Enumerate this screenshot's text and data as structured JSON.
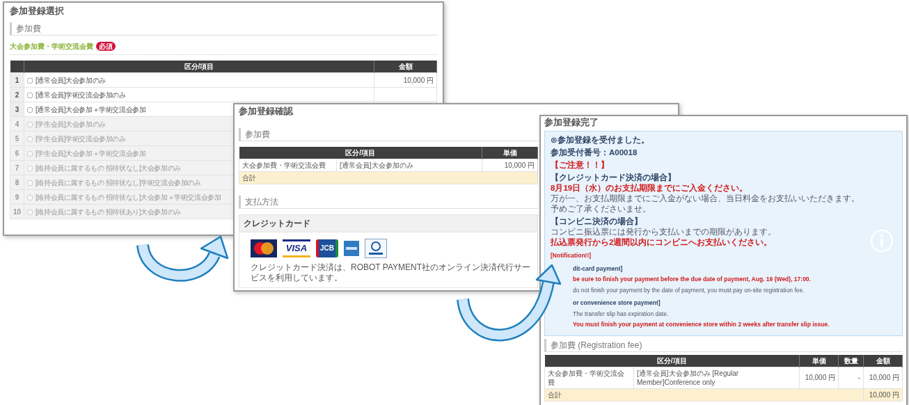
{
  "selection_window": {
    "title": "参加登録選択",
    "section": "参加費",
    "group": {
      "title": "大会参加費・学術交流会費",
      "badge": "必須"
    },
    "table": {
      "columns": [
        "区分/項目",
        "金額"
      ],
      "rows": [
        {
          "no": "1",
          "item": "[通常会員]大会参加のみ",
          "amount": "10,000 円",
          "checked": false,
          "disabled": false
        },
        {
          "no": "2",
          "item": "[通常会員]学術交流会参加のみ",
          "checked": false,
          "disabled": false
        },
        {
          "no": "3",
          "item": "[通常会員]大会参加＋学術交流会参加",
          "checked": false,
          "disabled": false
        },
        {
          "no": "4",
          "item": "[学生会員]大会参加のみ",
          "checked": false,
          "disabled": true
        },
        {
          "no": "5",
          "item": "[学生会員]学術交流会参加のみ",
          "checked": false,
          "disabled": true
        },
        {
          "no": "6",
          "item": "[学生会員]大会参加＋学術交流会参加",
          "checked": false,
          "disabled": true
        },
        {
          "no": "7",
          "item": "[維持会員に属するもの 招待状なし]大会参加のみ",
          "checked": false,
          "disabled": true
        },
        {
          "no": "8",
          "item": "[維持会員に属するもの 招待状なし]学術交流会参加のみ",
          "checked": false,
          "disabled": true
        },
        {
          "no": "9",
          "item": "[維持会員に属するもの 招待状なし]大会参加＋学術交流会参加",
          "checked": false,
          "disabled": true
        },
        {
          "no": "10",
          "item": "[維持会員に属するもの 招待状あり]大会参加のみ",
          "checked": false,
          "disabled": true
        }
      ]
    }
  },
  "confirm_window": {
    "title": "参加登録確認",
    "section": "参加費",
    "table": {
      "columns": [
        "区分/項目",
        "単価"
      ],
      "rows": [
        {
          "category": "大会参加費・学術交流会費",
          "item": "[通常会員]大会参加のみ",
          "unit_price": "10,000 円"
        }
      ],
      "total_label": "合計"
    },
    "payment_section": "支払方法",
    "payment_method": "クレジットカード",
    "cards": [
      {
        "kind": "mastercard"
      },
      {
        "kind": "visa",
        "text": "VISA"
      },
      {
        "kind": "jcb",
        "text": "JCB"
      },
      {
        "kind": "amex"
      },
      {
        "kind": "diners"
      }
    ],
    "note": "クレジットカード決済は、ROBOT PAYMENT社のオンライン決済代行サービスを利用しています。"
  },
  "complete_window": {
    "title": "参加登録完了",
    "notice": {
      "blocks": [
        {
          "kind": "plain",
          "lines": [
            {
              "kind": "heading",
              "text": "⊙参加登録を受付ました。"
            },
            {
              "kind": "label",
              "text": "参加受付番号：A00018"
            }
          ]
        },
        {
          "kind": "plain",
          "lines": [
            {
              "kind": "alert",
              "text": "【ご注意！！】"
            }
          ]
        },
        {
          "kind": "plain",
          "lines": [
            {
              "kind": "label",
              "text": "【クレジットカード決済の場合】"
            },
            {
              "kind": "emphasis",
              "text": "8月19日（水）のお支払期限までにご入金ください。"
            },
            {
              "kind": "text",
              "text": "万が一、お支払期限までにご入金がない場合、当日料金をお支払いいただきます。"
            },
            {
              "kind": "text",
              "text": "予めご了承くださいませ。"
            }
          ]
        },
        {
          "kind": "plain",
          "lines": [
            {
              "kind": "label",
              "text": "【コンビニ決済の場合】"
            },
            {
              "kind": "text",
              "text": "コンビニ振込票には発行から支払いまでの期限があります。"
            },
            {
              "kind": "emphasis",
              "text": "払込票発行から2週間以内にコンビニへお支払いください。"
            }
          ]
        },
        {
          "kind": "plain",
          "lines": [
            {
              "kind": "alert",
              "text": "[Notification!!]"
            }
          ]
        },
        {
          "kind": "indented",
          "lines": [
            {
              "kind": "label",
              "text": "dit-card payment]"
            },
            {
              "kind": "emphasis",
              "text": "be sure to finish your payment before the due date of payment, Aug. 19 (Wed), 17:00."
            },
            {
              "kind": "text",
              "text": "do not finish your payment by the date of payment, you must pay on-site registration fee."
            }
          ]
        },
        {
          "kind": "indented",
          "lines": [
            {
              "kind": "label",
              "text": "or convenience store payment]"
            },
            {
              "kind": "text",
              "text": "The transfer slip has expiration date."
            },
            {
              "kind": "emphasis",
              "text": "You must finish your payment at convenience store within 2 weeks after transfer slip issue."
            }
          ]
        }
      ]
    },
    "section": "参加費 (Registration fee)",
    "table": {
      "columns": [
        "区分/項目",
        "単価",
        "数量",
        "金額"
      ],
      "rows": [
        {
          "category": "大会参加費・学術交流会費",
          "item": "[通常会員]大会参加のみ [Regular Member]Conference only",
          "unit_price": "10,000 円",
          "quantity": "-",
          "amount": "10,000 円"
        }
      ],
      "total_label": "合計",
      "total": "10,000 円"
    }
  }
}
